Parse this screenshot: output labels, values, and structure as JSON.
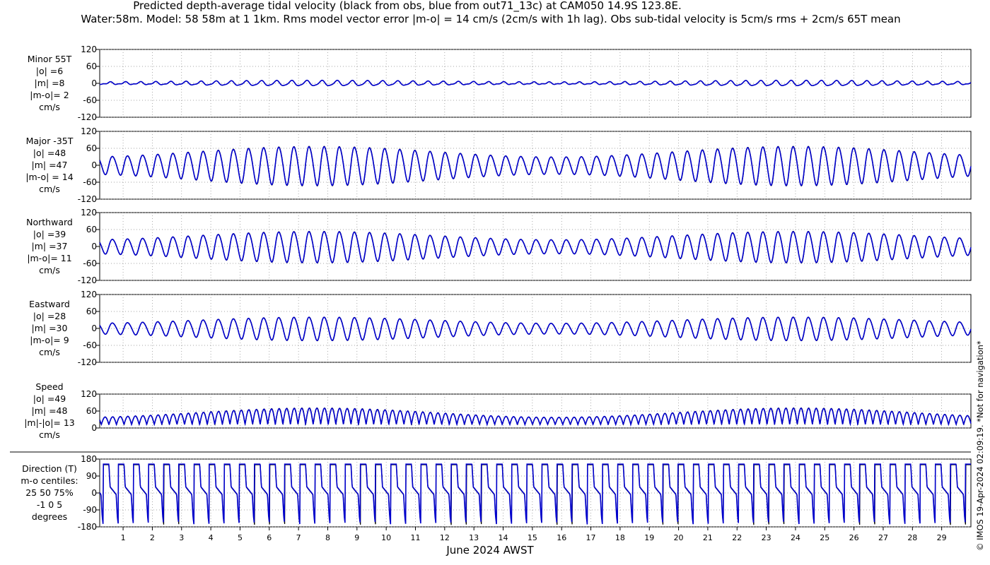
{
  "chart_data": {
    "type": "line",
    "title_line1": "Predicted depth-average tidal velocity (black from obs, blue from out71_13c) at CAM050 14.9S 123.8E.",
    "title_line2": "Water:58m. Model: 58 58m at 1 1km. Rms model vector error |m-o| = 14 cm/s (2cm/s with 1h lag). Obs sub-tidal velocity is 5cm/s rms + 2cm/s 65T mean",
    "xlabel": "June 2024 AWST",
    "x_ticks": [
      "1",
      "2",
      "3",
      "4",
      "5",
      "6",
      "7",
      "8",
      "9",
      "10",
      "11",
      "12",
      "13",
      "14",
      "15",
      "16",
      "17",
      "18",
      "19",
      "20",
      "21",
      "22",
      "23",
      "24",
      "25",
      "26",
      "27",
      "28",
      "29"
    ],
    "xlim_days": [
      0.2,
      30.0
    ],
    "side_note": "© IMOS 19-Apr-2024 02:09:19. *Not for navigation*",
    "grid": true,
    "colors": {
      "obs": "#000000",
      "model": "#0000cc",
      "grid": "#888888"
    },
    "series_legend": {
      "obs": "black from obs",
      "model": "blue from out71_13c"
    },
    "panels": [
      {
        "id": "minor",
        "label": [
          "Minor 55T",
          "|o| =6",
          "|m| =8",
          "|m-o|= 2",
          "cm/s"
        ],
        "ylim": [
          -120,
          120
        ],
        "yticks": [
          "120",
          "60",
          "0",
          "-60",
          "-120"
        ],
        "kind": "minor",
        "amp_base": 6,
        "amp_spring": 4
      },
      {
        "id": "major",
        "label": [
          "Major -35T",
          "|o| =48",
          "|m| =47",
          "|m-o| = 14",
          "cm/s"
        ],
        "ylim": [
          -120,
          120
        ],
        "yticks": [
          "120",
          "60",
          "0",
          "-60",
          "-120"
        ],
        "kind": "major",
        "amp_base": 48,
        "amp_spring": 48
      },
      {
        "id": "north",
        "label": [
          "Northward",
          "|o| =39",
          "|m| =37",
          "|m-o|= 11",
          "cm/s"
        ],
        "ylim": [
          -120,
          120
        ],
        "yticks": [
          "120",
          "60",
          "0",
          "-60",
          "-120"
        ],
        "kind": "major",
        "amp_base": 39,
        "amp_spring": 38
      },
      {
        "id": "east",
        "label": [
          "Eastward",
          "|o| =28",
          "|m| =30",
          "|m-o|= 9",
          "cm/s"
        ],
        "ylim": [
          -120,
          120
        ],
        "yticks": [
          "120",
          "60",
          "0",
          "-60",
          "-120"
        ],
        "kind": "major",
        "amp_base": 30,
        "amp_spring": 28
      },
      {
        "id": "speed",
        "label": [
          "Speed",
          "|o| =49",
          "|m| =48",
          "|m|-|o|= 13",
          "cm/s"
        ],
        "ylim": [
          0,
          120
        ],
        "yticks": [
          "120",
          "60",
          "0"
        ],
        "kind": "speed",
        "amp_base": 48,
        "amp_spring": 48
      },
      {
        "id": "direction",
        "label": [
          "Direction (T)",
          "m-o centiles:",
          "25  50  75%",
          "-1  0  5",
          "degrees"
        ],
        "ylim": [
          -180,
          180
        ],
        "yticks": [
          "180",
          "90",
          "0",
          "-90",
          "-180"
        ],
        "kind": "direction",
        "amp_base": 0,
        "amp_spring": 0
      }
    ]
  }
}
